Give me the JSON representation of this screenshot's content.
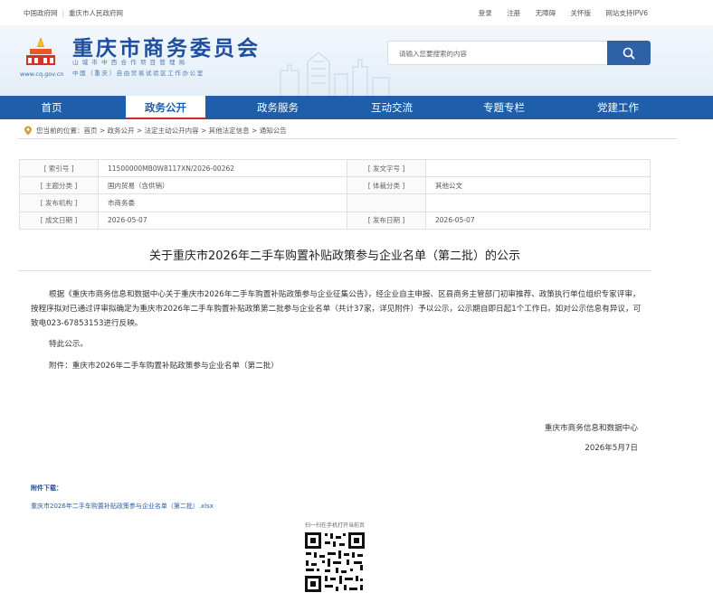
{
  "topbar": {
    "links_left": [
      "中国政府网",
      "重庆市人民政府网"
    ],
    "links_right": [
      "登录",
      "注册",
      "无障碍",
      "关怀版",
      "网站支持IPV6"
    ]
  },
  "header": {
    "site_title": "重庆市商务委员会",
    "subtitle_1": "山城市中西合作项目管理局",
    "subtitle_2": "中国（重庆）自由贸易试验区工作办公室",
    "url": "www.cq.gov.cn",
    "search_placeholder": "请输入您要搜索的内容"
  },
  "nav": {
    "items": [
      "首页",
      "政务公开",
      "政务服务",
      "互动交流",
      "专题专栏",
      "党建工作"
    ],
    "active_index": 1
  },
  "breadcrumb": {
    "text": "您当前的位置：首页 > 政务公开 > 法定主动公开内容 > 其他法定信息 > 通知公告"
  },
  "meta": {
    "rows": [
      {
        "k1": "[ 索引号 ]",
        "v1": "11500000MB0W8117XN/2026-00262",
        "k2": "[ 发文字号 ]",
        "v2": ""
      },
      {
        "k1": "[ 主题分类 ]",
        "v1": "国内贸易（含供销）",
        "k2": "[ 体裁分类 ]",
        "v2": "其他公文"
      },
      {
        "k1": "[ 发布机构 ]",
        "v1": "市商务委",
        "k2": "",
        "v2": ""
      },
      {
        "k1": "[ 成文日期 ]",
        "v1": "2026-05-07",
        "k2": "[ 发布日期 ]",
        "v2": "2026-05-07"
      }
    ]
  },
  "doc": {
    "title": "关于重庆市2026年二手车购置补贴政策参与企业名单（第二批）的公示",
    "para1": "根据《重庆市商务信息和数据中心关于重庆市2026年二手车购置补贴政策参与企业征集公告》，经企业自主申报、区县商务主管部门初审推荐、政策执行单位组织专家评审，按程序拟对已通过评审拟确定为重庆市2026年二手车购置补贴政策第二批参与企业名单（共计37家，详见附件）予以公示，公示期自即日起1个工作日。如对公示信息有异议，可致电023-67853153进行反映。",
    "para2": "特此公示。",
    "para3": "附件：重庆市2026年二手车购置补贴政策参与企业名单（第二批）",
    "sign_org": "重庆市商务信息和数据中心",
    "sign_date": "2026年5月7日"
  },
  "attachments": {
    "label": "附件下载：",
    "file": "重庆市2026年二手车购置补贴政策参与企业名单（第二批）.xlsx"
  },
  "qr": {
    "label": "扫一扫在手机打开当前页"
  },
  "colors": {
    "nav_bg": "#1f5ea8",
    "title_blue": "#1d4f9e",
    "active_underline": "#c62b2b"
  }
}
